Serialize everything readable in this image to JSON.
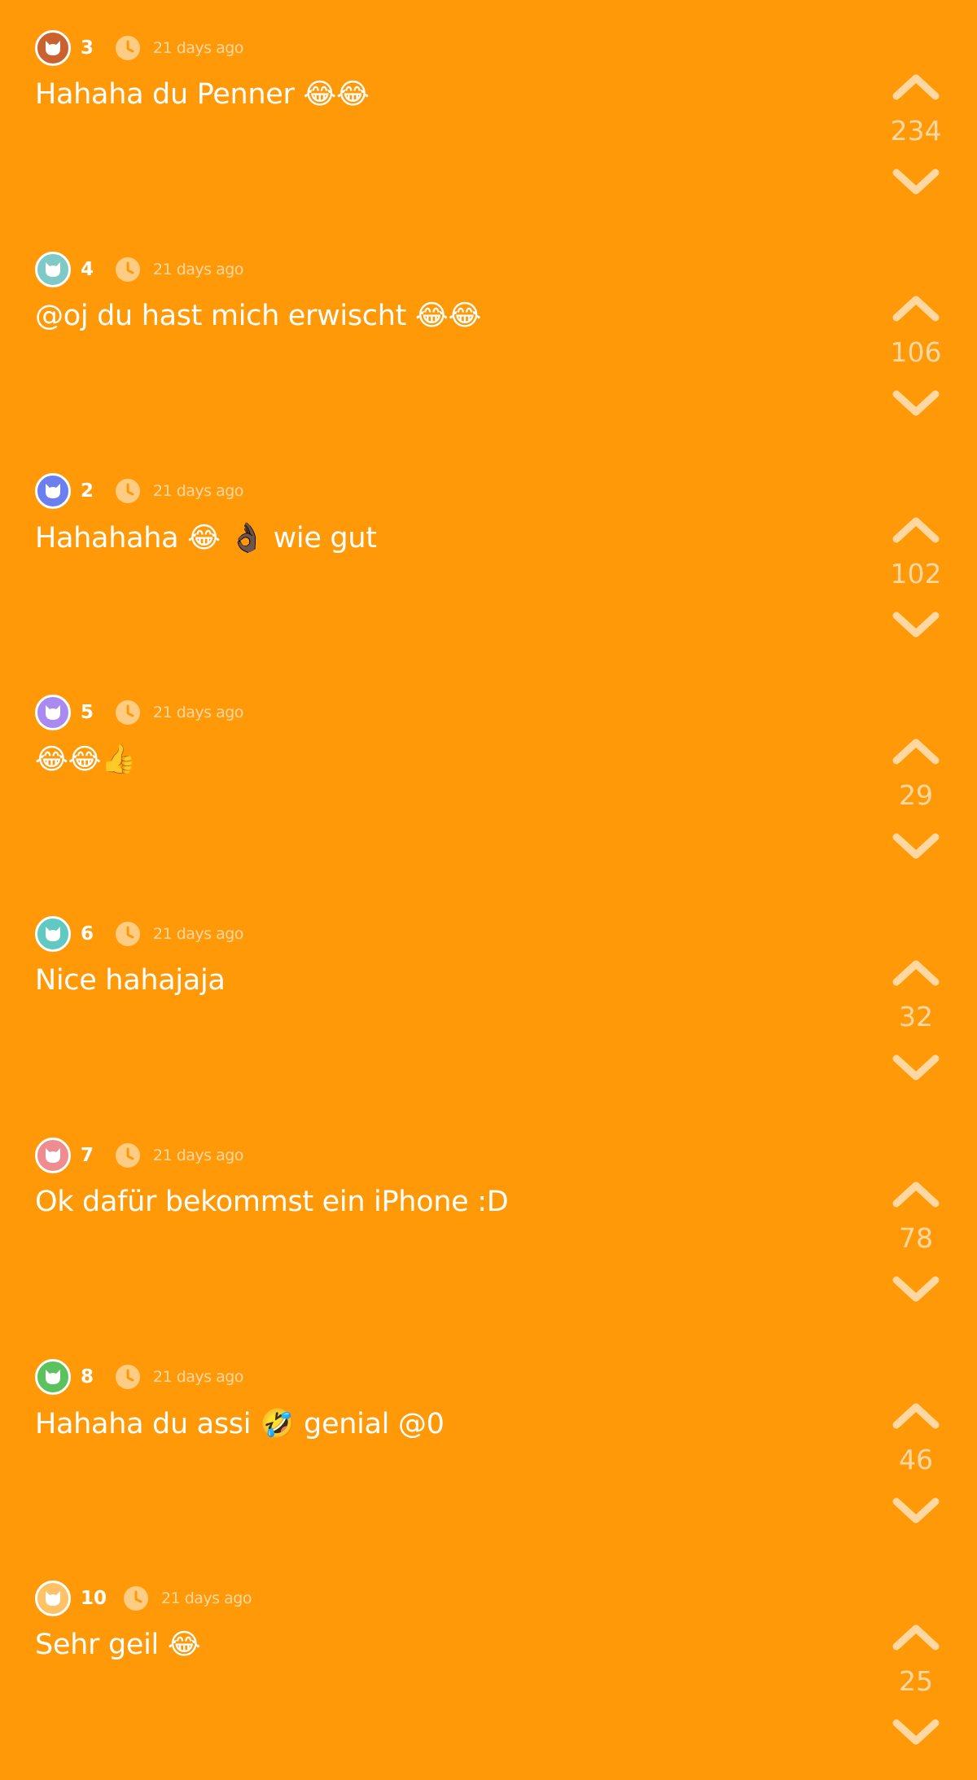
{
  "comments": [
    {
      "user": "3",
      "avatar_color": "#C9622E",
      "time": "21 days ago",
      "text": "Hahaha du Penner 😂😂",
      "votes": "234"
    },
    {
      "user": "4",
      "avatar_color": "#7FC9C6",
      "time": "21 days ago",
      "text": "@oj du hast mich erwischt 😂😂",
      "votes": "106"
    },
    {
      "user": "2",
      "avatar_color": "#6B7FEF",
      "time": "21 days ago",
      "text": "Hahahaha 😂 👌🏿 wie gut",
      "votes": "102"
    },
    {
      "user": "5",
      "avatar_color": "#A88AF0",
      "time": "21 days ago",
      "text": "😂😂👍",
      "votes": "29"
    },
    {
      "user": "6",
      "avatar_color": "#5FC9C2",
      "time": "21 days ago",
      "text": "Nice hahajaja",
      "votes": "32"
    },
    {
      "user": "7",
      "avatar_color": "#EE8C8F",
      "time": "21 days ago",
      "text": "Ok dafür bekommst ein iPhone :D",
      "votes": "78"
    },
    {
      "user": "8",
      "avatar_color": "#5CC25E",
      "time": "21 days ago",
      "text": "Hahaha du assi 🤣 genial @0",
      "votes": "46"
    },
    {
      "user": "10",
      "avatar_color": "#FFC266",
      "time": "21 days ago",
      "text": "Sehr geil 😂",
      "votes": "25"
    }
  ],
  "icons": {
    "avatar": "cat-icon",
    "time": "clock-icon",
    "upvote": "chevron-up-icon",
    "downvote": "chevron-down-icon"
  }
}
